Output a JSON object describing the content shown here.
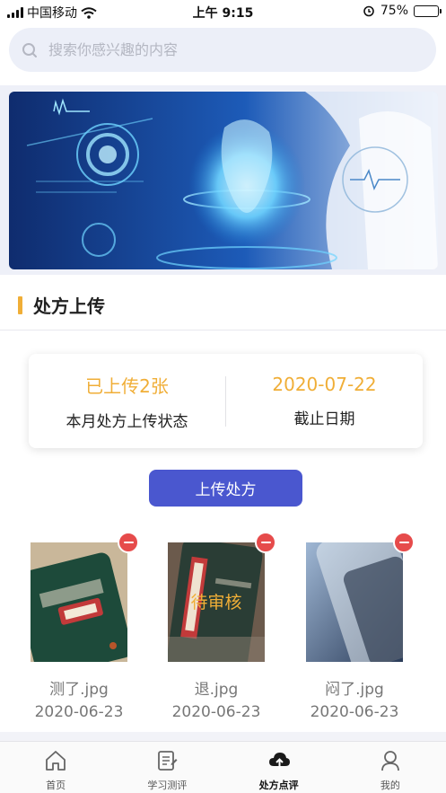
{
  "status_bar": {
    "carrier": "中国移动",
    "time": "上午 9:15",
    "battery": "75%",
    "battery_level": 0.75
  },
  "search": {
    "placeholder": "搜索你感兴趣的内容"
  },
  "section": {
    "title": "处方上传"
  },
  "summary": {
    "uploaded_value": "已上传2张",
    "uploaded_label": "本月处方上传状态",
    "deadline_value": "2020-07-22",
    "deadline_label": "截止日期"
  },
  "upload_button": "上传处方",
  "files": [
    {
      "name": "测了.jpg",
      "date": "2020-06-23",
      "status": ""
    },
    {
      "name": "退.jpg",
      "date": "2020-06-23",
      "status": "待审核"
    },
    {
      "name": "闷了.jpg",
      "date": "2020-06-23",
      "status": ""
    }
  ],
  "tabs": [
    {
      "label": "首页",
      "icon": "home-icon"
    },
    {
      "label": "学习测评",
      "icon": "clipboard-icon"
    },
    {
      "label": "处方点评",
      "icon": "cloud-upload-icon",
      "active": true
    },
    {
      "label": "我的",
      "icon": "user-icon"
    }
  ],
  "colors": {
    "accent": "#f0ae37",
    "primary": "#4a57cf",
    "danger": "#e64b4b"
  }
}
